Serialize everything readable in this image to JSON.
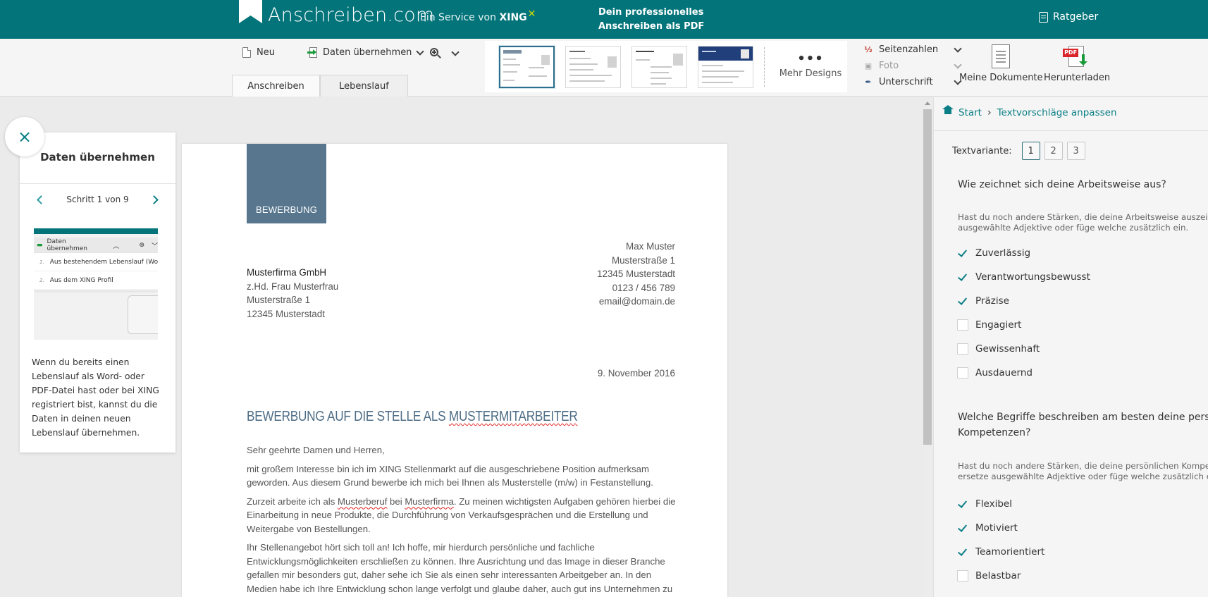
{
  "header": {
    "brand": "Anschreiben.com",
    "service_prefix": "Ein Service von",
    "service_brand": "XING",
    "tagline_line1": "Dein professionelles",
    "tagline_line2": "Anschreiben als PDF",
    "ratgeber": "Ratgeber",
    "colors": {
      "header_bg": "#03747a",
      "xing_accent": "#c9d90a"
    }
  },
  "toolbar": {
    "neu": "Neu",
    "daten_uebernehmen": "Daten übernehmen",
    "tabs": [
      "Anschreiben",
      "Lebenslauf"
    ],
    "designs_count_shown": 4,
    "mehr_designs": "Mehr Designs",
    "options": [
      {
        "label": "Seitenzahlen",
        "icon": "page-numbers-icon",
        "enabled": true
      },
      {
        "label": "Foto",
        "icon": "photo-icon",
        "enabled": false
      },
      {
        "label": "Unterschrift",
        "icon": "signature-pen-icon",
        "enabled": true
      }
    ],
    "meine_dokumente": "Meine Dokumente",
    "herunterladen": "Herunterladen",
    "pdf_tag": "PDF"
  },
  "help": {
    "title": "Daten übernehmen",
    "step": "Schritt 1 von 9",
    "preview_row": "Daten übernehmen",
    "preview_items": [
      {
        "n": "1.",
        "label": "Aus bestehendem Lebenslauf (Word-"
      },
      {
        "n": "2.",
        "label": "Aus dem XING Profil"
      }
    ],
    "text": "Wenn du bereits einen Lebenslauf als Word- oder PDF-Datei hast oder bei XING registriert bist, kannst du die Daten in deinen neuen Lebenslauf übernehmen."
  },
  "document": {
    "badge": "BEWERBUNG",
    "sender": [
      "Max Muster",
      "Musterstraße 1",
      "12345 Musterstadt",
      "0123 / 456 789",
      "email@domain.de"
    ],
    "recipient_firm": "Musterfirma GmbH",
    "recipient": [
      "z.Hd. Frau Musterfrau",
      "Musterstraße 1",
      "12345 Musterstadt"
    ],
    "date": "9. November 2016",
    "subject_pre": "BEWERBUNG AUF DIE STELLE ALS ",
    "subject_word": "MUSTERMITARBEITER",
    "greeting": "Sehr geehrte Damen und Herren,",
    "p1": "mit großem Interesse bin ich im XING Stellenmarkt auf die ausgeschriebene Position aufmerksam geworden. Aus diesem Grund bewerbe ich mich bei Ihnen als Musterstelle (m/w) in Festanstellung.",
    "p2_a": "Zurzeit arbeite ich als ",
    "p2_w1": "Musterberuf",
    "p2_b": " bei ",
    "p2_w2": "Musterfirma",
    "p2_c": ". Zu meinen wichtigsten Aufgaben gehören hierbei die Einarbeitung in neue Produkte, die Durchführung von Verkaufsgesprächen und die Erstellung und Weitergabe von Bestellungen.",
    "p3": "Ihr Stellenangebot hört sich toll an! Ich hoffe, mir hierdurch persönliche und fachliche Entwicklungsmöglichkeiten erschließen zu können. Ihre Ausrichtung und das Image in dieser Branche gefallen mir besonders gut, daher sehe ich Sie als einen sehr interessanten Arbeitgeber an. In den Medien habe ich Ihre Entwicklung schon lange verfolgt und glaube daher, auch gut ins Unternehmen zu"
  },
  "right": {
    "crumb_start": "Start",
    "crumb_current": "Textvorschläge anpassen",
    "variant_label": "Textvariante:",
    "variants": [
      "1",
      "2",
      "3"
    ],
    "variant_selected": "1",
    "q1": "Wie zeichnet sich deine Arbeitsweise aus?",
    "hint1_l1": "Hast du noch andere Stärken, die deine Arbeitsweise auszeichne",
    "hint1_l2": "ausgewählte Adjektive oder füge welche zusätzlich ein.",
    "list1": [
      {
        "label": "Zuverlässig",
        "checked": true
      },
      {
        "label": "Verantwortungsbewusst",
        "checked": true
      },
      {
        "label": "Präzise",
        "checked": true
      },
      {
        "label": "Engagiert",
        "checked": false
      },
      {
        "label": "Gewissenhaft",
        "checked": false
      },
      {
        "label": "Ausdauernd",
        "checked": false
      }
    ],
    "q2_l1": "Welche Begriffe beschreiben am besten deine persö",
    "q2_l2": "Kompetenzen?",
    "hint2_l1": "Hast du noch andere Stärken, die deine persönlichen Kompeten",
    "hint2_l2": "ersetze ausgewählte Adjektive oder füge welche zusätzlich ein.",
    "list2": [
      {
        "label": "Flexibel",
        "checked": true
      },
      {
        "label": "Motiviert",
        "checked": true
      },
      {
        "label": "Teamorientiert",
        "checked": true
      },
      {
        "label": "Belastbar",
        "checked": false
      }
    ]
  }
}
